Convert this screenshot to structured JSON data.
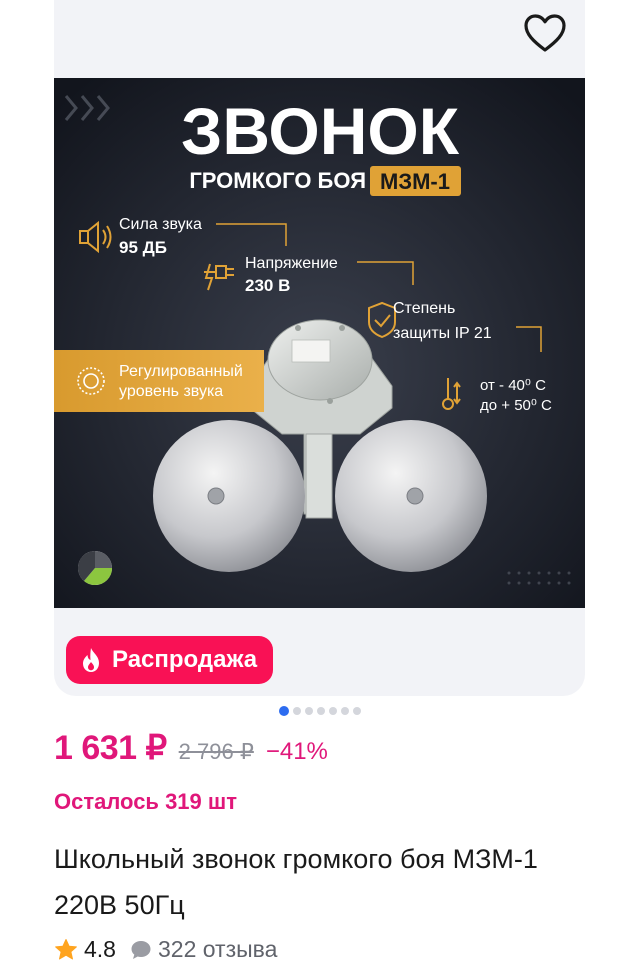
{
  "product": {
    "image": {
      "headline": "ЗВОНОК",
      "subline": "ГРОМКОГО БОЯ",
      "model_badge": "МЗМ-1",
      "features": [
        {
          "label": "Сила звука",
          "value": "95 ДБ"
        },
        {
          "label": "Напряжение",
          "value": "230 В"
        },
        {
          "label": "Степень",
          "value": "защиты IP 21"
        },
        {
          "label": "от - 40⁰ С",
          "value": "до + 50⁰ С"
        }
      ],
      "banner": [
        "Регулированный",
        "уровень звука"
      ]
    },
    "badge_label": "Распродажа",
    "gallery": {
      "count": 7,
      "active": 0
    },
    "price": {
      "current": "1 631 ₽",
      "old": "2 796 ₽",
      "discount": "−41%"
    },
    "stock_text": "Осталось 319 шт",
    "title": "Школьный звонок громкого боя МЗМ-1 220В 50Гц",
    "rating": "4.8",
    "reviews": "322 отзыва"
  },
  "colors": {
    "accent": "#e0177a",
    "badge_bg": "#f91155",
    "image_bg": "#161a24",
    "image_accent": "#e0a236",
    "star": "#ffa41f",
    "pager_active": "#2d6cf0"
  },
  "icons": {
    "favorite": "heart-outline-icon",
    "badge": "fire-icon",
    "rating": "star-icon",
    "reviews": "speech-bubble-icon"
  }
}
